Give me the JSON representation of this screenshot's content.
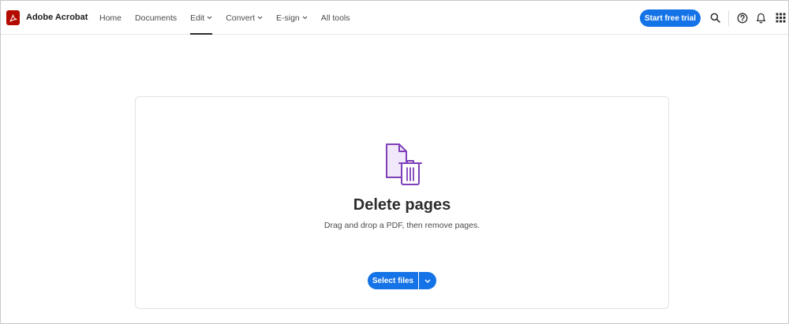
{
  "header": {
    "brand": "Adobe Acrobat",
    "nav": [
      {
        "label": "Home",
        "has_dropdown": false,
        "active": false
      },
      {
        "label": "Documents",
        "has_dropdown": false,
        "active": false
      },
      {
        "label": "Edit",
        "has_dropdown": true,
        "active": true
      },
      {
        "label": "Convert",
        "has_dropdown": true,
        "active": false
      },
      {
        "label": "E-sign",
        "has_dropdown": true,
        "active": false
      },
      {
        "label": "All tools",
        "has_dropdown": false,
        "active": false
      }
    ],
    "trial_label": "Start free trial",
    "icons": [
      "search-icon",
      "help-icon",
      "bell-icon",
      "apps-grid-icon"
    ]
  },
  "tool": {
    "icon": "delete-pages-icon",
    "title": "Delete pages",
    "subtitle": "Drag and drop a PDF, then remove pages.",
    "select_label": "Select files"
  },
  "colors": {
    "accent": "#1473e6",
    "brand_red": "#b30b00",
    "icon_purple": "#7e3fb8",
    "icon_fill": "#f1e8fb"
  }
}
